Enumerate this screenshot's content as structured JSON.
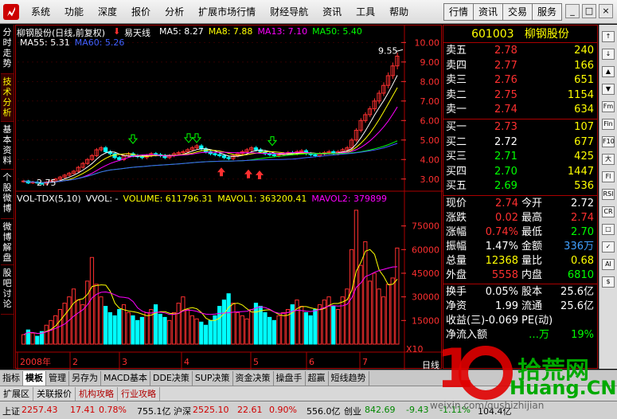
{
  "menu": {
    "items": [
      "系统",
      "功能",
      "深度",
      "报价",
      "分析",
      "扩展市场行情",
      "财经导航",
      "资讯",
      "工具",
      "帮助"
    ],
    "right_buttons": [
      "行情",
      "资讯",
      "交易",
      "服务"
    ],
    "window_buttons": [
      "_",
      "□",
      "×"
    ]
  },
  "left_tabs": [
    "分时走势",
    "技术分析",
    "基本资料",
    "个股微博",
    "微博解盘",
    "股吧讨论"
  ],
  "chart": {
    "title": "柳钢股份(日线,前复权)",
    "indicator_name": "易天线",
    "ma_line1": [
      {
        "label": "MA5: 8.27",
        "color": "#ffffff"
      },
      {
        "label": "MA8: 7.88",
        "color": "#ffff00"
      },
      {
        "label": "MA13: 7.10",
        "color": "#ff00ff"
      },
      {
        "label": "MA50: 5.40",
        "color": "#00ff00"
      }
    ],
    "ma_line2": [
      {
        "label": "MA55: 5.31",
        "color": "#ffffff"
      },
      {
        "label": "MA60: 5.26",
        "color": "#4060ff"
      }
    ],
    "vol_header": [
      {
        "label": "VOL-TDX(5,10)",
        "color": "#ffffff"
      },
      {
        "label": "VVOL: -",
        "color": "#ffffff"
      },
      {
        "label": "VOLUME: 611796.31",
        "color": "#ffff00"
      },
      {
        "label": "MAVOL1: 363200.41",
        "color": "#ffff00"
      },
      {
        "label": "MAVOL2: 379899",
        "color": "#ff00ff"
      }
    ],
    "x_labels": [
      "2008年",
      "2",
      "3",
      "4",
      "5",
      "6",
      "7"
    ],
    "x10_label": "X10",
    "day_label": "日线"
  },
  "chart_data": {
    "type": "candlestick",
    "price_axis": [
      10.0,
      9.0,
      8.0,
      7.0,
      6.0,
      5.0,
      4.0,
      3.0
    ],
    "volume_axis": [
      75000,
      60000,
      45000,
      30000,
      15000
    ],
    "annotations": [
      {
        "text": "9.55"
      },
      {
        "text": "2.75"
      }
    ],
    "close": [
      2.9,
      2.8,
      2.85,
      2.8,
      2.75,
      2.85,
      2.9,
      3.0,
      3.1,
      3.2,
      3.3,
      3.4,
      3.6,
      3.8,
      4.0,
      4.2,
      4.5,
      4.6,
      4.4,
      4.3,
      4.1,
      4.0,
      4.2,
      4.3,
      4.2,
      4.15,
      4.1,
      4.2,
      4.3,
      4.25,
      4.2,
      4.1,
      4.2,
      4.3,
      4.35,
      4.4,
      4.5,
      4.6,
      4.7,
      4.55,
      4.4,
      4.3,
      4.25,
      4.2,
      4.1,
      4.05,
      4.2,
      4.3,
      4.4,
      4.5,
      4.6,
      4.5,
      4.4,
      4.3,
      4.25,
      4.2,
      4.25,
      4.3,
      4.35,
      4.3,
      4.4,
      4.45,
      4.3,
      4.25,
      4.2,
      4.3,
      4.35,
      4.4,
      4.3,
      4.4,
      4.5,
      4.6,
      5.0,
      5.5,
      6.0,
      6.3,
      6.6,
      7.0,
      7.4,
      7.8,
      8.3,
      8.8,
      9.3
    ],
    "volume": [
      6000,
      9000,
      7000,
      5000,
      8000,
      12000,
      15000,
      18000,
      22000,
      26000,
      30000,
      35000,
      28000,
      25000,
      40000,
      55000,
      38000,
      30000,
      24000,
      20000,
      18000,
      22000,
      25000,
      20000,
      18000,
      15000,
      17000,
      20000,
      22000,
      25000,
      19000,
      17000,
      15000,
      20000,
      26000,
      30000,
      22000,
      18000,
      16000,
      14000,
      12000,
      15000,
      18000,
      24000,
      28000,
      32000,
      26000,
      20000,
      18000,
      16000,
      22000,
      26000,
      24000,
      20000,
      17000,
      15000,
      18000,
      20000,
      22000,
      25000,
      28000,
      24000,
      20000,
      18000,
      22000,
      25000,
      28000,
      30000,
      24000,
      22000,
      30000,
      35000,
      60000,
      85000,
      50000,
      65000,
      40000,
      45000,
      35000,
      30000,
      38000,
      42000,
      61000
    ]
  },
  "quote": {
    "code": "601003",
    "name": "柳钢股份",
    "asks": [
      {
        "label": "卖五",
        "price": "2.78",
        "vol": "240"
      },
      {
        "label": "卖四",
        "price": "2.77",
        "vol": "166"
      },
      {
        "label": "卖三",
        "price": "2.76",
        "vol": "651"
      },
      {
        "label": "卖二",
        "price": "2.75",
        "vol": "1154"
      },
      {
        "label": "卖一",
        "price": "2.74",
        "vol": "634"
      }
    ],
    "bids": [
      {
        "label": "买一",
        "price": "2.73",
        "vol": "107"
      },
      {
        "label": "买二",
        "price": "2.72",
        "vol": "677"
      },
      {
        "label": "买三",
        "price": "2.71",
        "vol": "425"
      },
      {
        "label": "买四",
        "price": "2.70",
        "vol": "1447"
      },
      {
        "label": "买五",
        "price": "2.69",
        "vol": "536"
      }
    ],
    "stats": [
      {
        "l1": "现价",
        "v1": "2.74",
        "c1": "#ff3030",
        "l2": "今开",
        "v2": "2.72",
        "c2": "#ffffff"
      },
      {
        "l1": "涨跌",
        "v1": "0.02",
        "c1": "#ff3030",
        "l2": "最高",
        "v2": "2.74",
        "c2": "#ff3030"
      },
      {
        "l1": "涨幅",
        "v1": "0.74%",
        "c1": "#ff3030",
        "l2": "最低",
        "v2": "2.70",
        "c2": "#00ff00"
      },
      {
        "l1": "振幅",
        "v1": "1.47%",
        "c1": "#ffffff",
        "l2": "金额",
        "v2": "336万",
        "c2": "#40a0ff"
      },
      {
        "l1": "总量",
        "v1": "12368",
        "c1": "#ffff00",
        "l2": "量比",
        "v2": "0.68",
        "c2": "#ffff00"
      },
      {
        "l1": "外盘",
        "v1": "5558",
        "c1": "#ff3030",
        "l2": "内盘",
        "v2": "6810",
        "c2": "#00ff00"
      }
    ],
    "stats2": [
      {
        "l1": "换手",
        "v1": "0.05%",
        "l2": "股本",
        "v2": "25.6亿"
      },
      {
        "l1": "净资",
        "v1": "1.99",
        "l2": "流通",
        "v2": "25.6亿"
      }
    ],
    "pe_row": {
      "l1": "收益(三)",
      "v1": "-0.069",
      "l2": "PE(动)",
      "v2": ""
    },
    "net_inflow": {
      "label": "净流入额",
      "value": "…万",
      "pct": "19%"
    }
  },
  "right_icons": [
    "↑",
    "↓",
    "▲",
    "▼",
    "Fm",
    "Fin",
    "F10",
    "大",
    "Fl",
    "RSI",
    "CR",
    "□",
    "✓",
    "AI",
    "$"
  ],
  "bottom_tabs": [
    "指标",
    "模板",
    "管理",
    "另存为",
    "MACD基本",
    "DDE决策",
    "SUP决策",
    "资金决策",
    "操盘手",
    "超赢",
    "短线趋势"
  ],
  "bottom_tabs_active": "模板",
  "link_tabs": [
    {
      "label": "扩展区",
      "color": "#000000"
    },
    {
      "label": "关联报价",
      "color": "#000000"
    },
    {
      "label": "机构攻略",
      "color": "#b00000"
    },
    {
      "label": "行业攻略",
      "color": "#b00000"
    }
  ],
  "status": {
    "sh_label": "上证",
    "sh_val": "2257.43",
    "sh_chg": "17.41",
    "sh_pct": "0.78%",
    "sh_amt": "755.1亿",
    "sz_label": "沪深",
    "sz_val": "2525.10",
    "sz_chg": "22.61",
    "sz_pct": "0.90%",
    "sz_amt": "556.0亿",
    "cy_label": "创业",
    "cy_val": "842.69",
    "cy_chg": "-9.43",
    "cy_pct": "-1.11%",
    "cy_amt": "104.4亿"
  },
  "watermark": {
    "text": "拾荒网",
    "brand": "Huang.CN",
    "url": "weixin.com/qushizhijian"
  },
  "colors": {
    "up": "#ff3030",
    "down": "#00ffff",
    "border": "#aa0000",
    "axis": "#ff3030"
  }
}
